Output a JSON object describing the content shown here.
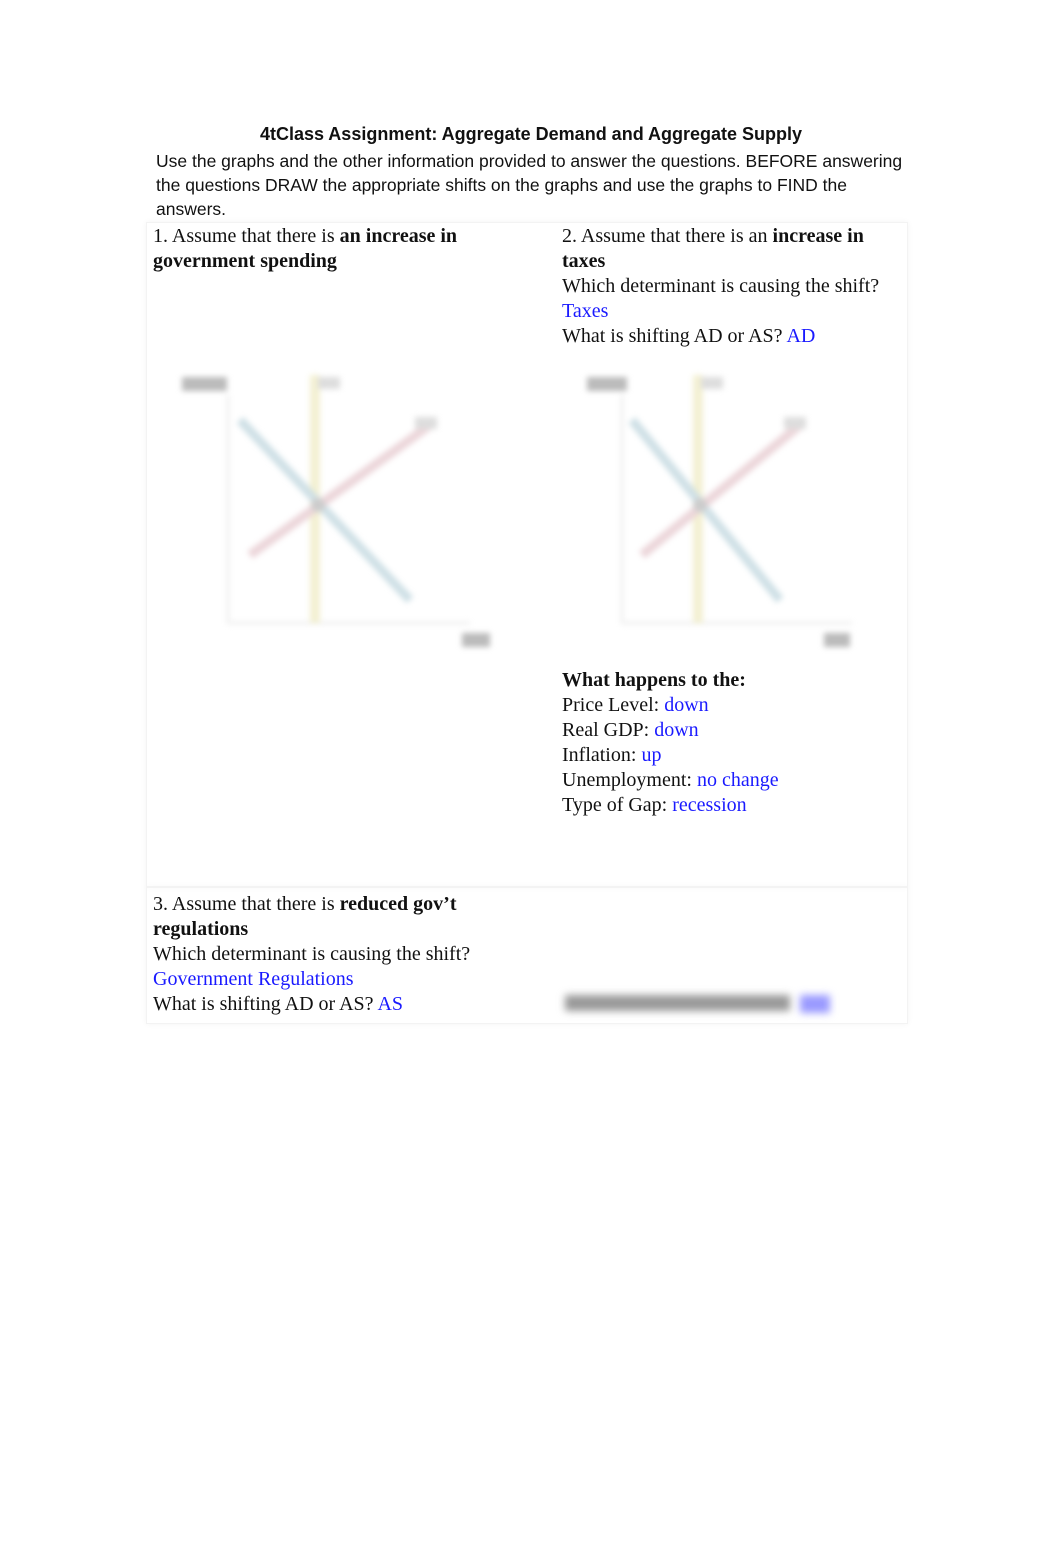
{
  "title": "4tClass Assignment: Aggregate Demand and Aggregate Supply",
  "intro": "Use the graphs and the other information provided to answer the questions. BEFORE answering the questions DRAW the appropriate shifts on the graphs and use the graphs to FIND the answers.",
  "q1": {
    "prefix": "1. Assume that there is ",
    "bold": "an increase in government spending"
  },
  "q2": {
    "prefix": "2. Assume that there is an ",
    "bold": "increase in taxes",
    "determinant_label": "Which determinant is causing the shift?",
    "determinant": "Taxes",
    "shifting_label": "What is shifting AD or AS?",
    "shifting": "AD",
    "happens_heading": "What happens to the:",
    "results": [
      {
        "label": "Price Level:",
        "value": "down"
      },
      {
        "label": "Real GDP:",
        "value": "down"
      },
      {
        "label": "Inflation:",
        "value": "up"
      },
      {
        "label": "Unemployment:",
        "value": "no change"
      },
      {
        "label": "Type of Gap:",
        "value": "recession"
      }
    ]
  },
  "q3": {
    "prefix": "3. Assume that there is ",
    "bold": "reduced gov’t regulations",
    "determinant_label": "Which determinant is causing the shift?",
    "determinant": "Government Regulations",
    "shifting_label": "What is shifting AD or AS?",
    "shifting": "AS"
  },
  "colors": {
    "answer": "#1a1aff",
    "ad_line": "#cfe0e6",
    "as_line": "#ecd6da",
    "lras_line": "#f3f0d2"
  }
}
